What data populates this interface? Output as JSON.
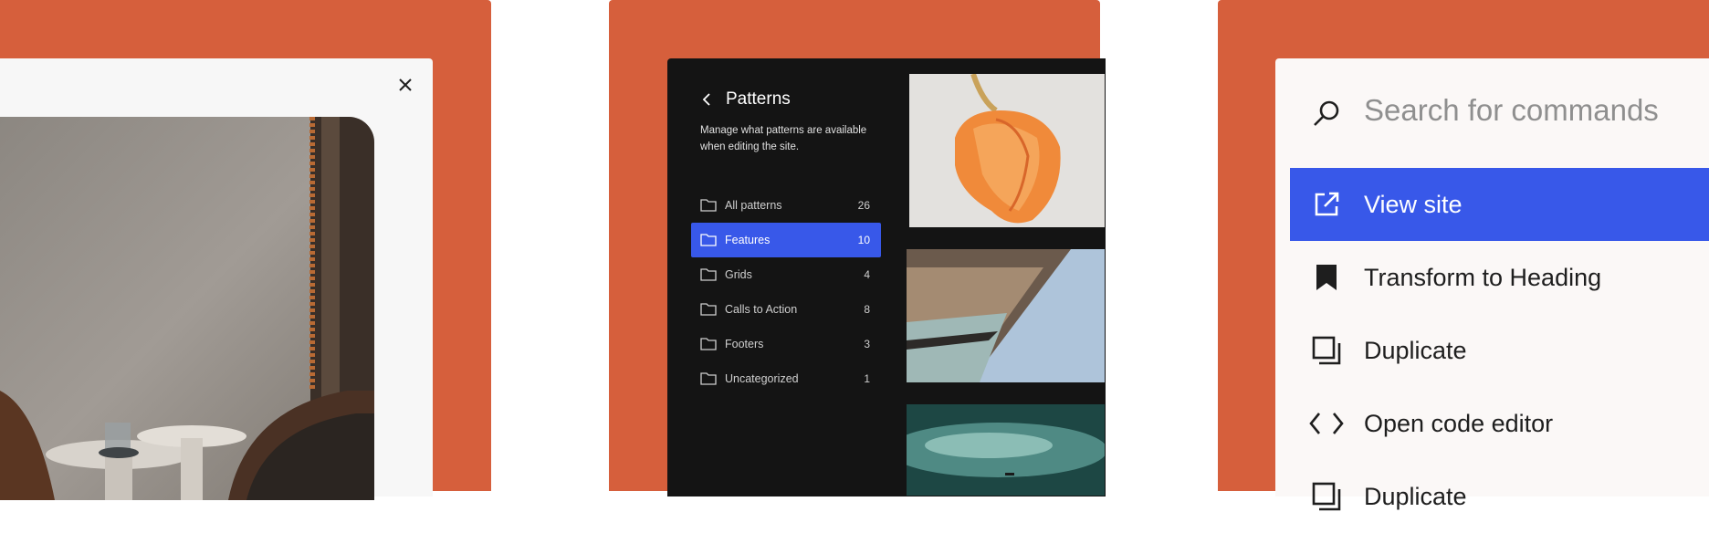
{
  "panel_left": {
    "close_icon": "close-icon"
  },
  "patterns": {
    "title": "Patterns",
    "description": "Manage what patterns are available when editing the site.",
    "items": [
      {
        "label": "All patterns",
        "count": "26",
        "active": false
      },
      {
        "label": "Features",
        "count": "10",
        "active": true
      },
      {
        "label": "Grids",
        "count": "4",
        "active": false
      },
      {
        "label": "Calls to Action",
        "count": "8",
        "active": false
      },
      {
        "label": "Footers",
        "count": "3",
        "active": false
      },
      {
        "label": "Uncategorized",
        "count": "1",
        "active": false
      }
    ]
  },
  "command_palette": {
    "search_placeholder": "Search for commands",
    "commands": [
      {
        "label": "View site",
        "icon": "external-link-icon",
        "active": true
      },
      {
        "label": "Transform to Heading",
        "icon": "bookmark-icon",
        "active": false
      },
      {
        "label": "Duplicate",
        "icon": "duplicate-icon",
        "active": false
      },
      {
        "label": "Open code editor",
        "icon": "code-icon",
        "active": false
      },
      {
        "label": "Duplicate",
        "icon": "duplicate-icon",
        "active": false
      }
    ]
  },
  "colors": {
    "accent_orange": "#d65f3c",
    "highlight_blue": "#3858e9",
    "dark_panel": "#141414"
  }
}
